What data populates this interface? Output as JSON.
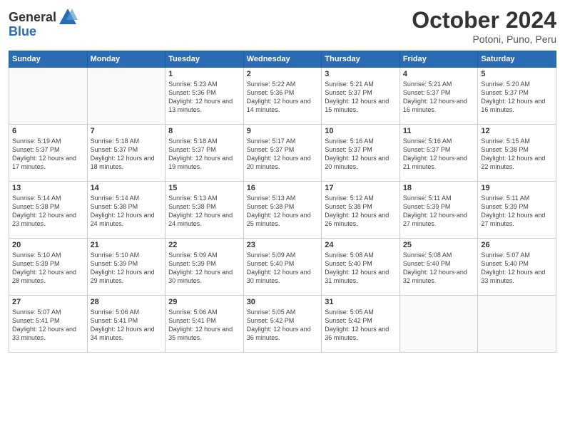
{
  "logo": {
    "general": "General",
    "blue": "Blue"
  },
  "header": {
    "month": "October 2024",
    "location": "Potoni, Puno, Peru"
  },
  "weekdays": [
    "Sunday",
    "Monday",
    "Tuesday",
    "Wednesday",
    "Thursday",
    "Friday",
    "Saturday"
  ],
  "weeks": [
    [
      {
        "day": "",
        "info": ""
      },
      {
        "day": "",
        "info": ""
      },
      {
        "day": "1",
        "info": "Sunrise: 5:23 AM\nSunset: 5:36 PM\nDaylight: 12 hours and 13 minutes."
      },
      {
        "day": "2",
        "info": "Sunrise: 5:22 AM\nSunset: 5:36 PM\nDaylight: 12 hours and 14 minutes."
      },
      {
        "day": "3",
        "info": "Sunrise: 5:21 AM\nSunset: 5:37 PM\nDaylight: 12 hours and 15 minutes."
      },
      {
        "day": "4",
        "info": "Sunrise: 5:21 AM\nSunset: 5:37 PM\nDaylight: 12 hours and 16 minutes."
      },
      {
        "day": "5",
        "info": "Sunrise: 5:20 AM\nSunset: 5:37 PM\nDaylight: 12 hours and 16 minutes."
      }
    ],
    [
      {
        "day": "6",
        "info": "Sunrise: 5:19 AM\nSunset: 5:37 PM\nDaylight: 12 hours and 17 minutes."
      },
      {
        "day": "7",
        "info": "Sunrise: 5:18 AM\nSunset: 5:37 PM\nDaylight: 12 hours and 18 minutes."
      },
      {
        "day": "8",
        "info": "Sunrise: 5:18 AM\nSunset: 5:37 PM\nDaylight: 12 hours and 19 minutes."
      },
      {
        "day": "9",
        "info": "Sunrise: 5:17 AM\nSunset: 5:37 PM\nDaylight: 12 hours and 20 minutes."
      },
      {
        "day": "10",
        "info": "Sunrise: 5:16 AM\nSunset: 5:37 PM\nDaylight: 12 hours and 20 minutes."
      },
      {
        "day": "11",
        "info": "Sunrise: 5:16 AM\nSunset: 5:37 PM\nDaylight: 12 hours and 21 minutes."
      },
      {
        "day": "12",
        "info": "Sunrise: 5:15 AM\nSunset: 5:38 PM\nDaylight: 12 hours and 22 minutes."
      }
    ],
    [
      {
        "day": "13",
        "info": "Sunrise: 5:14 AM\nSunset: 5:38 PM\nDaylight: 12 hours and 23 minutes."
      },
      {
        "day": "14",
        "info": "Sunrise: 5:14 AM\nSunset: 5:38 PM\nDaylight: 12 hours and 24 minutes."
      },
      {
        "day": "15",
        "info": "Sunrise: 5:13 AM\nSunset: 5:38 PM\nDaylight: 12 hours and 24 minutes."
      },
      {
        "day": "16",
        "info": "Sunrise: 5:13 AM\nSunset: 5:38 PM\nDaylight: 12 hours and 25 minutes."
      },
      {
        "day": "17",
        "info": "Sunrise: 5:12 AM\nSunset: 5:38 PM\nDaylight: 12 hours and 26 minutes."
      },
      {
        "day": "18",
        "info": "Sunrise: 5:11 AM\nSunset: 5:39 PM\nDaylight: 12 hours and 27 minutes."
      },
      {
        "day": "19",
        "info": "Sunrise: 5:11 AM\nSunset: 5:39 PM\nDaylight: 12 hours and 27 minutes."
      }
    ],
    [
      {
        "day": "20",
        "info": "Sunrise: 5:10 AM\nSunset: 5:39 PM\nDaylight: 12 hours and 28 minutes."
      },
      {
        "day": "21",
        "info": "Sunrise: 5:10 AM\nSunset: 5:39 PM\nDaylight: 12 hours and 29 minutes."
      },
      {
        "day": "22",
        "info": "Sunrise: 5:09 AM\nSunset: 5:39 PM\nDaylight: 12 hours and 30 minutes."
      },
      {
        "day": "23",
        "info": "Sunrise: 5:09 AM\nSunset: 5:40 PM\nDaylight: 12 hours and 30 minutes."
      },
      {
        "day": "24",
        "info": "Sunrise: 5:08 AM\nSunset: 5:40 PM\nDaylight: 12 hours and 31 minutes."
      },
      {
        "day": "25",
        "info": "Sunrise: 5:08 AM\nSunset: 5:40 PM\nDaylight: 12 hours and 32 minutes."
      },
      {
        "day": "26",
        "info": "Sunrise: 5:07 AM\nSunset: 5:40 PM\nDaylight: 12 hours and 33 minutes."
      }
    ],
    [
      {
        "day": "27",
        "info": "Sunrise: 5:07 AM\nSunset: 5:41 PM\nDaylight: 12 hours and 33 minutes."
      },
      {
        "day": "28",
        "info": "Sunrise: 5:06 AM\nSunset: 5:41 PM\nDaylight: 12 hours and 34 minutes."
      },
      {
        "day": "29",
        "info": "Sunrise: 5:06 AM\nSunset: 5:41 PM\nDaylight: 12 hours and 35 minutes."
      },
      {
        "day": "30",
        "info": "Sunrise: 5:05 AM\nSunset: 5:42 PM\nDaylight: 12 hours and 36 minutes."
      },
      {
        "day": "31",
        "info": "Sunrise: 5:05 AM\nSunset: 5:42 PM\nDaylight: 12 hours and 36 minutes."
      },
      {
        "day": "",
        "info": ""
      },
      {
        "day": "",
        "info": ""
      }
    ]
  ]
}
